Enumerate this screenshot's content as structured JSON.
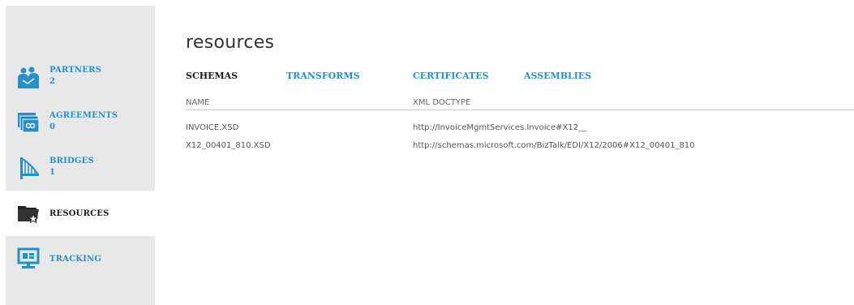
{
  "sidebar": {
    "items": [
      {
        "label": "PARTNERS",
        "count": "2",
        "icon": "partners-icon"
      },
      {
        "label": "AGREEMENTS",
        "count": "0",
        "icon": "agreements-icon"
      },
      {
        "label": "BRIDGES",
        "count": "1",
        "icon": "bridges-icon"
      },
      {
        "label": "RESOURCES",
        "count": "",
        "icon": "resources-icon"
      },
      {
        "label": "TRACKING",
        "count": "",
        "icon": "tracking-icon"
      }
    ]
  },
  "main": {
    "title": "resources",
    "tabs": [
      {
        "label": "SCHEMAS"
      },
      {
        "label": "TRANSFORMS"
      },
      {
        "label": "CERTIFICATES"
      },
      {
        "label": "ASSEMBLIES"
      }
    ],
    "table": {
      "columns": [
        "NAME",
        "XML DOCTYPE"
      ],
      "rows": [
        [
          "INVOICE.XSD",
          "http://InvoiceMgmtServices.Invoice#X12__"
        ],
        [
          "X12_00401_810.XSD",
          "http://schemas.microsoft.com/BizTalk/EDI/X12/2006#X12_00401_810"
        ]
      ]
    }
  },
  "colors": {
    "accent": "#2591c8",
    "sidebar_bg": "#e8e8e8",
    "active_text": "#1a1a1a"
  }
}
